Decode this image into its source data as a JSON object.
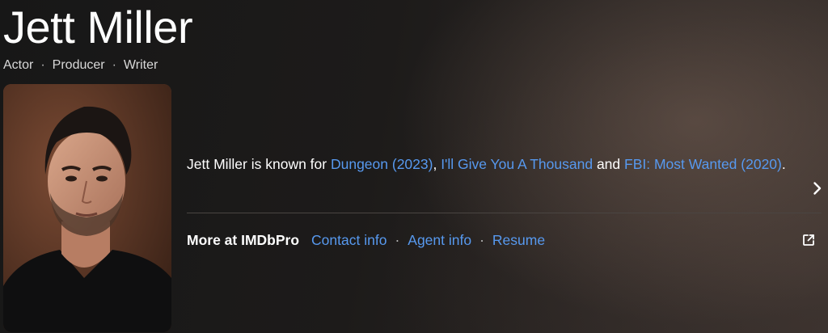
{
  "person": {
    "name": "Jett Miller",
    "roles": [
      "Actor",
      "Producer",
      "Writer"
    ],
    "role_separator": "·"
  },
  "bio": {
    "prefix": "Jett Miller is known for ",
    "known_for": [
      {
        "title": "Dungeon (2023)"
      },
      {
        "title": "I'll Give You A Thousand"
      },
      {
        "title": "FBI: Most Wanted (2020)"
      }
    ],
    "sep_comma": ", ",
    "sep_and": " and ",
    "suffix": "."
  },
  "imdbpro": {
    "label": "More at IMDbPro",
    "links": [
      "Contact info",
      "Agent info",
      "Resume"
    ],
    "separator": "·"
  },
  "icons": {
    "expand": "chevron-right-icon",
    "external": "external-link-icon"
  },
  "colors": {
    "link": "#5799ef",
    "text": "#ffffff",
    "muted": "#d9d9d9"
  }
}
